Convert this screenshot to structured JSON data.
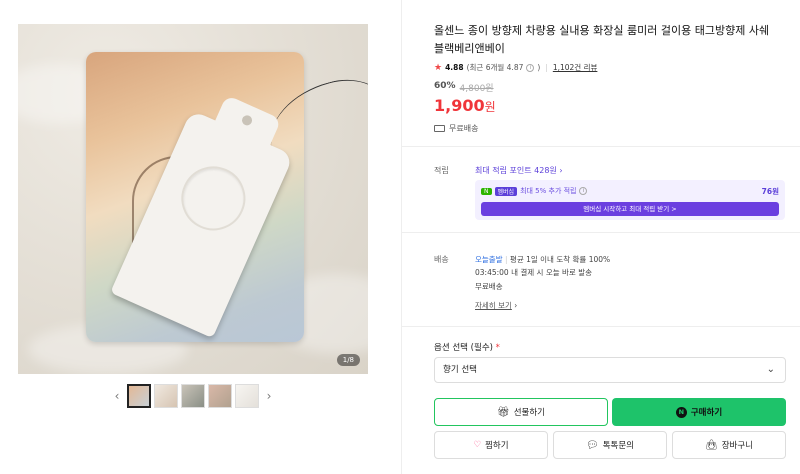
{
  "product": {
    "title": "올센느 종이 방향제 차량용 실내용 화장실 룸미러 걸이용 태그방향제 사쉐 블랙베리앤베이",
    "rating": "4.88",
    "rating_recent": "(최근 6개월 4.87",
    "review_count": "1,102건 리뷰",
    "discount": "60%",
    "original_price": "4,800원",
    "price": "1,900",
    "price_unit": "원",
    "shipping": "무료배송"
  },
  "gallery": {
    "counter": "1/8",
    "prev_icon": "chevron-left-icon",
    "next_icon": "chevron-right-icon"
  },
  "points": {
    "label": "적립",
    "title": "최대 적립 포인트 428원",
    "badge_n": "N",
    "badge_membership": "멤버십",
    "extra": "최대 5% 추가 적립",
    "amount": "76원",
    "cta": "멤버십 시작하고 최대 적립 받기 >"
  },
  "delivery": {
    "label": "배송",
    "today": "오늘출발",
    "today_desc": "평균 1일 이내 도착 확률 100%",
    "cutoff": "03:45:00  내 결제 시 오늘 바로 발송",
    "free": "무료배송",
    "detail": "자세히 보기"
  },
  "options": {
    "label": "옵션 선택 (필수)",
    "required_mark": "*",
    "select_value": "향기 선택"
  },
  "actions": {
    "gift": "선물하기",
    "buy": "구매하기",
    "wish": "찜하기",
    "talk": "톡톡문의",
    "cart": "장바구니"
  },
  "colors": {
    "price_red": "#f0353a",
    "buy_green": "#1ec36a",
    "points_purple": "#5b3fd9"
  }
}
